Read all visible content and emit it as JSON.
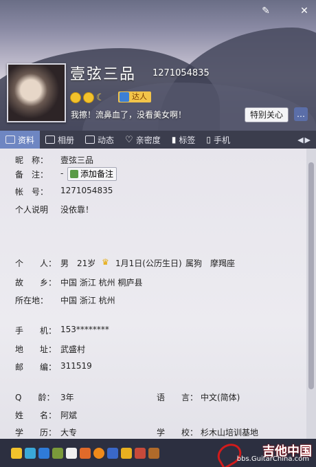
{
  "window": {
    "skin_btn": "✎",
    "close_btn": "✕"
  },
  "profile": {
    "nickname": "壹弦三品",
    "qq_number": "1271054835",
    "badge": "达人",
    "signature": "我擦！流鼻血了，没看美女啊！",
    "special_care_btn": "特别关心",
    "chat_btn_icon": "chat-icon"
  },
  "tabs": [
    {
      "label": "资料",
      "icon": "profile-card-icon",
      "active": true
    },
    {
      "label": "相册",
      "icon": "album-icon"
    },
    {
      "label": "动态",
      "icon": "feed-icon"
    },
    {
      "label": "亲密度",
      "icon": "heart-icon"
    },
    {
      "label": "标签",
      "icon": "bookmark-icon"
    },
    {
      "label": "手机",
      "icon": "phone-icon"
    }
  ],
  "info": {
    "nick_label": "昵　称：",
    "nick_value": "壹弦三品",
    "remark_label": "备　注：",
    "remark_value": "-",
    "add_remark_btn": "添加备注",
    "account_label": "帐　号：",
    "account_value": "1271054835",
    "desc_label": "个人说明",
    "desc_value": "没依靠！",
    "personal_label": "个　　人：",
    "gender": "男",
    "age": "21岁",
    "birthday": "1月1日(公历生日)",
    "zodiac": "属狗",
    "constellation": "摩羯座",
    "hometown_label": "故　　乡：",
    "hometown_value": "中国 浙江 杭州 桐庐县",
    "location_label": "所在地：",
    "location_value": "中国 浙江 杭州",
    "mobile_label": "手　　机：",
    "mobile_value": "153********",
    "address_label": "地　　址：",
    "address_value": "武盛村",
    "zip_label": "邮　　编：",
    "zip_value": "311519",
    "qage_label": "Q　　龄：",
    "qage_value": "3年",
    "lang_label": "语　　言：",
    "lang_value": "中文(简体)",
    "name_label": "姓　　名：",
    "name_value": "阿斌",
    "edu_label": "学　　历：",
    "edu_value": "大专",
    "school_label": "学　　校：",
    "school_value": "杉木山培训基地"
  },
  "watermark": {
    "title": "吉他中国",
    "url": "bbs.GuitarChina.com"
  },
  "colors": {
    "tab_active": "#6e86c2",
    "tab_bar": "#3b3d4d",
    "bottom_bar": "#2c2f40"
  }
}
